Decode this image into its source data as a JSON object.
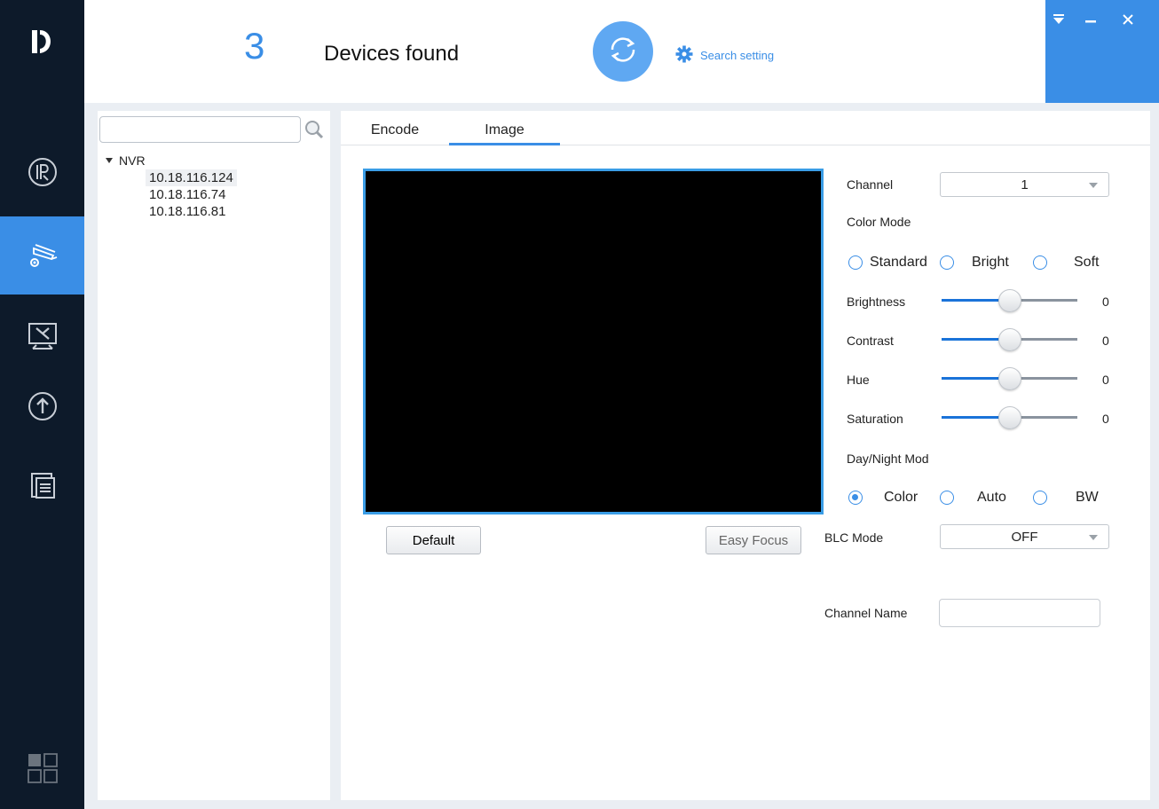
{
  "header": {
    "device_count": "3",
    "devices_found_label": "Devices found",
    "search_setting_label": "Search setting"
  },
  "window_controls": [
    "menu-icon",
    "minimize-icon",
    "close-icon"
  ],
  "rail": {
    "items": [
      {
        "icon": "ip-icon",
        "active": false
      },
      {
        "icon": "camera-settings-icon",
        "active": true
      },
      {
        "icon": "tools-icon",
        "active": false
      },
      {
        "icon": "upgrade-icon",
        "active": false
      },
      {
        "icon": "documents-icon",
        "active": false
      }
    ],
    "bottom_icon": "apps-grid-icon"
  },
  "tree": {
    "search_placeholder": "",
    "root_label": "NVR",
    "devices": [
      "10.18.116.124",
      "10.18.116.74",
      "10.18.116.81"
    ],
    "selected_index": 0
  },
  "tabs": [
    {
      "label": "Encode",
      "active": false
    },
    {
      "label": "Image",
      "active": true
    }
  ],
  "preview": {
    "default_button": "Default",
    "easy_focus_button": "Easy Focus"
  },
  "settings": {
    "channel_label": "Channel",
    "channel_value": "1",
    "color_mode_label": "Color Mode",
    "color_modes": [
      "Standard",
      "Bright",
      "Soft"
    ],
    "color_mode_selected": null,
    "sliders": [
      {
        "label": "Brightness",
        "value": "0",
        "fraction": 0.5
      },
      {
        "label": "Contrast",
        "value": "0",
        "fraction": 0.5
      },
      {
        "label": "Hue",
        "value": "0",
        "fraction": 0.5
      },
      {
        "label": "Saturation",
        "value": "0",
        "fraction": 0.5
      }
    ],
    "day_night_label": "Day/Night Mod",
    "day_night_options": [
      "Color",
      "Auto",
      "BW"
    ],
    "day_night_selected": "Color",
    "blc_label": "BLC Mode",
    "blc_value": "OFF",
    "channel_name_label": "Channel Name",
    "channel_name_value": ""
  },
  "colors": {
    "accent": "#3a8ee6",
    "rail_bg": "#0d1a2a"
  }
}
